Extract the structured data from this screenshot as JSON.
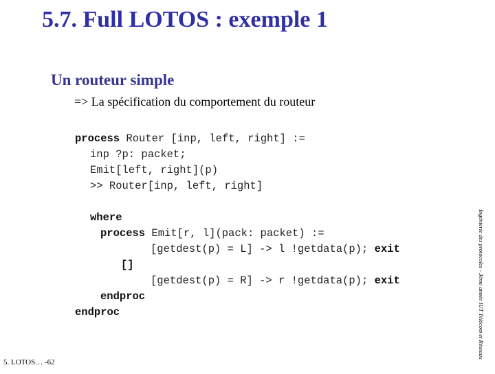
{
  "slide": {
    "title": "5.7. Full LOTOS : exemple 1",
    "subtitle": "Un routeur simple",
    "bullet": "=> La spécification du comportement du routeur",
    "code": {
      "line1_kw": "process",
      "line1_rest": " Router [inp, left, right] :=",
      "line2": "inp ?p: packet;",
      "line3": "Emit[left, right](p)",
      "line4": ">> Router[inp, left, right]",
      "line5_kw": "where",
      "line6_kw": "process",
      "line6_rest": " Emit[r, l](pack: packet) :=",
      "line7_rest": "[getdest(p) = L] -> l !getdata(p); ",
      "line7_kw": "exit",
      "line8_kw": "[]",
      "line9_rest": "[getdest(p) = R] -> r !getdata(p); ",
      "line9_kw": "exit",
      "line10_kw": "endproc",
      "line11_kw": "endproc"
    },
    "sidebar_text": "Ingénierie des protocoles - 3ème année IUT Télécom et Réseaux",
    "footer": "5. LOTOS… -62"
  }
}
